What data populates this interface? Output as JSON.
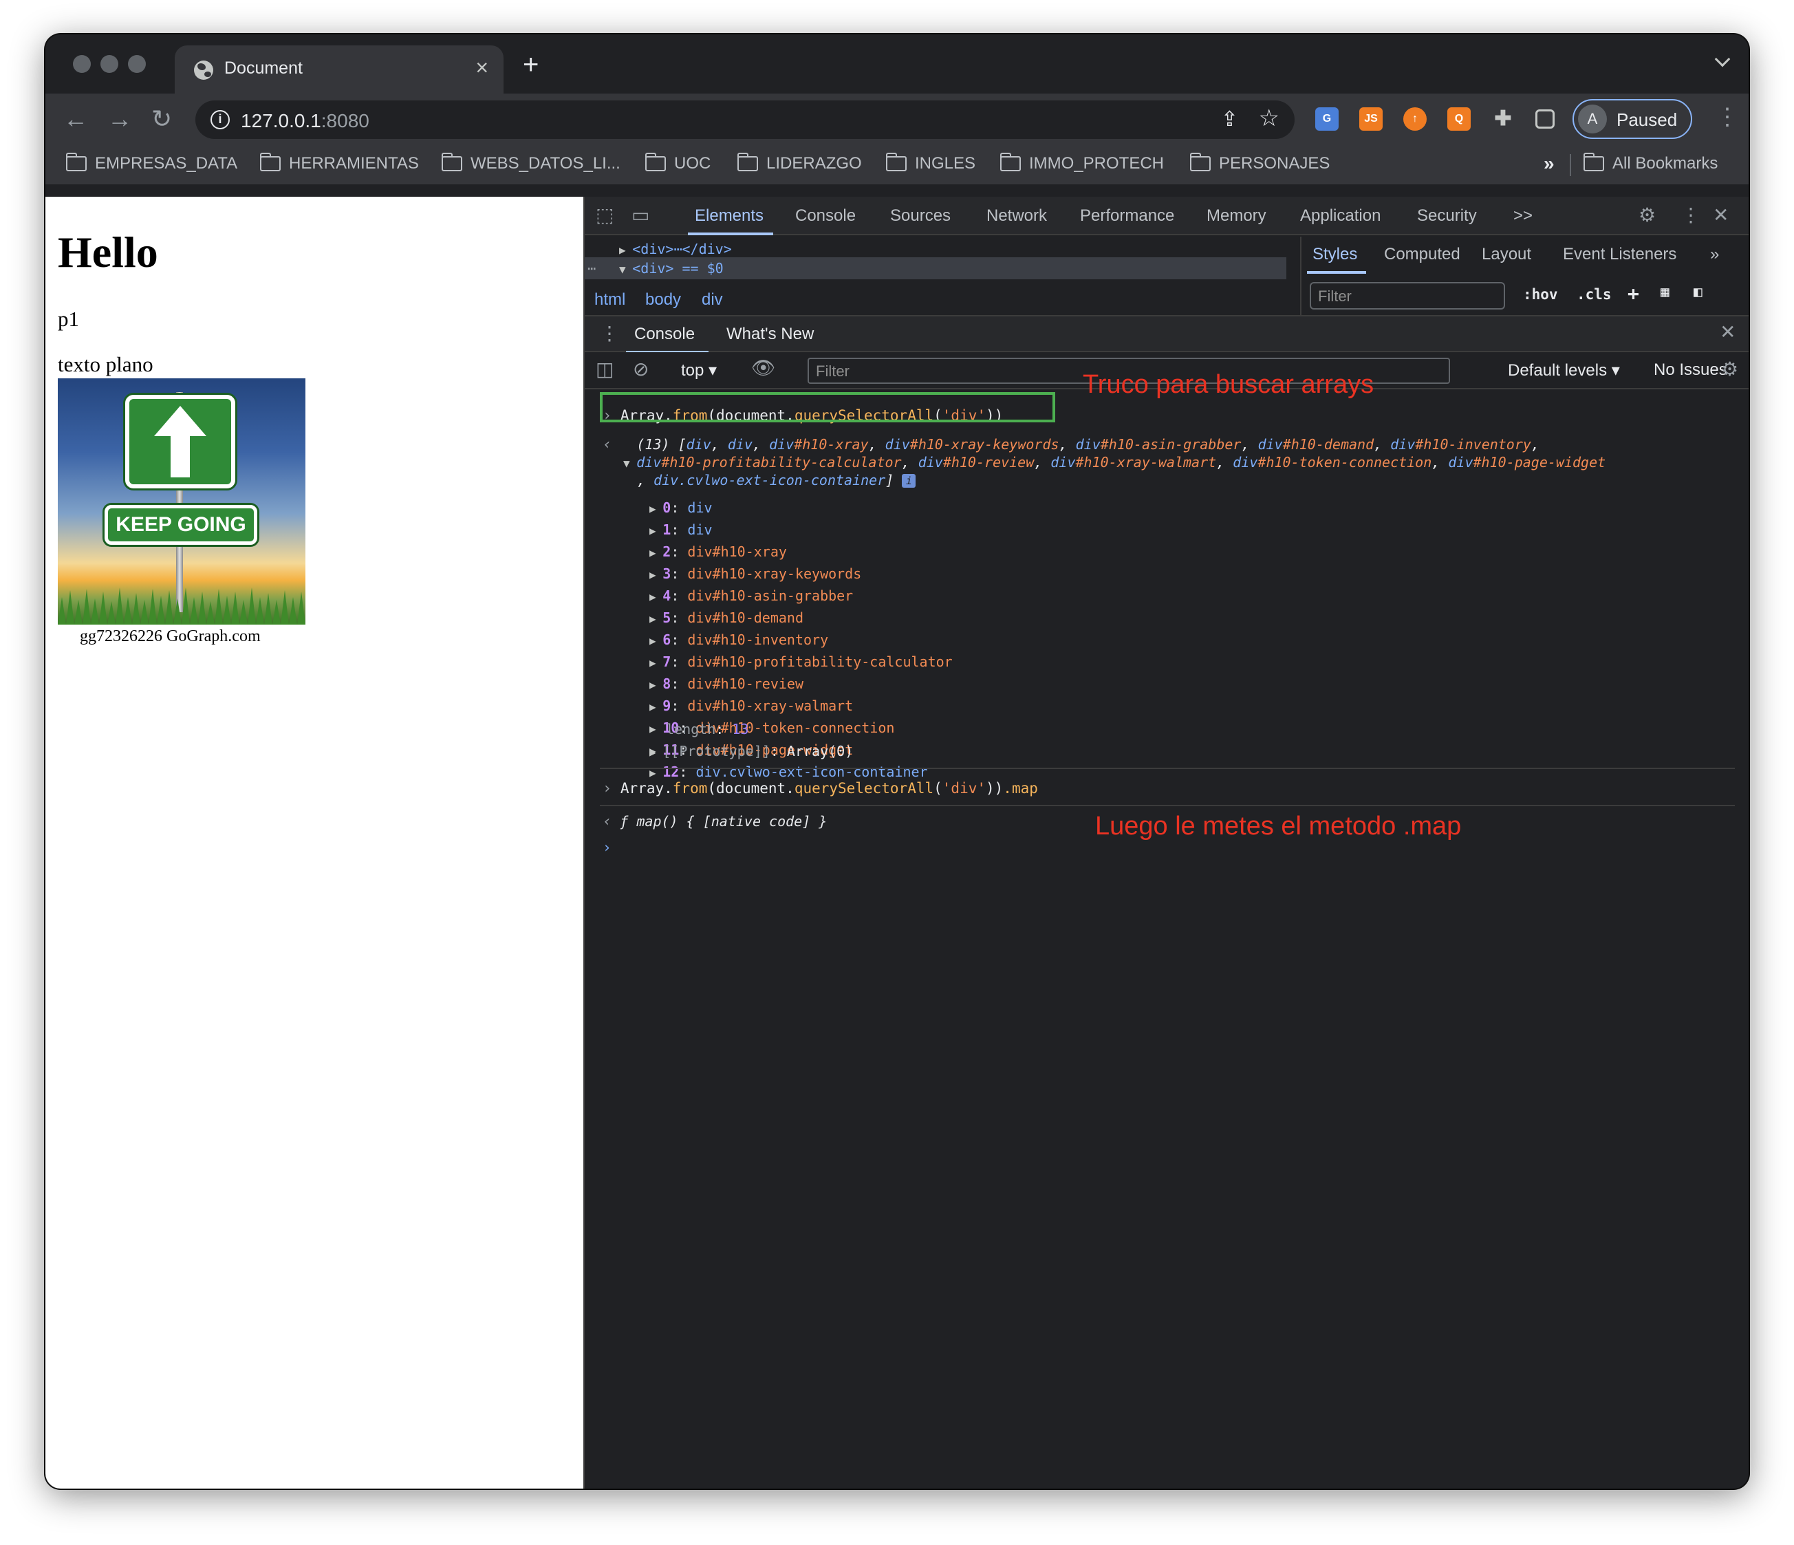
{
  "browser": {
    "tab_title": "Document",
    "tab_close": "×",
    "new_tab": "+",
    "url_host": "127.0.0.1",
    "url_port": ":8080",
    "profile_initial": "A",
    "profile_status": "Paused",
    "bookmarks": [
      "EMPRESAS_DATA",
      "HERRAMIENTAS",
      "WEBS_DATOS_LI...",
      "UOC",
      "LIDERAZGO",
      "INGLES",
      "IMMO_PROTECH",
      "PERSONAJES"
    ],
    "bookmarks_more": "»",
    "all_bookmarks": "All Bookmarks"
  },
  "page": {
    "heading": "Hello",
    "p1": "p1",
    "plain_text": "texto plano",
    "image_sign_text": "KEEP GOING",
    "image_caption": "gg72326226 GoGraph.com"
  },
  "devtools": {
    "tabs": [
      "Elements",
      "Console",
      "Sources",
      "Network",
      "Performance",
      "Memory",
      "Application",
      "Security"
    ],
    "more_tabs": ">>",
    "elements_line1": "<div>⋯</div>",
    "elements_line2": "<div> == $0",
    "breadcrumbs": [
      "html",
      "body",
      "div"
    ],
    "styles_tabs": [
      "Styles",
      "Computed",
      "Layout",
      "Event Listeners"
    ],
    "styles_filter_placeholder": "Filter",
    "styles_hov": ":hov",
    "styles_cls": ".cls",
    "drawer_tabs": [
      "Console",
      "What's New"
    ],
    "context": "top",
    "console_filter_placeholder": "Filter",
    "levels": "Default levels ▾",
    "issues": "No Issues"
  },
  "console": {
    "cmd1_obj": "Array",
    "cmd1_from": "from",
    "cmd1_doc": "document",
    "cmd1_qsa": "querySelectorAll",
    "cmd1_arg": "'div'",
    "summary_count": "(13)",
    "summary_line1": [
      {
        "t": "div",
        "k": "tag"
      },
      {
        "t": "div",
        "k": "tag"
      },
      {
        "t": "div#h10-xray",
        "k": "id"
      },
      {
        "t": "div#h10-xray-keywords",
        "k": "id"
      },
      {
        "t": "div#h10-asin-grabber",
        "k": "id"
      },
      {
        "t": "div#h10-demand",
        "k": "id"
      },
      {
        "t": "div#h10-inventory",
        "k": "id"
      }
    ],
    "summary_line2": [
      {
        "t": "div#h10-profitability-calculator",
        "k": "id"
      },
      {
        "t": "div#h10-review",
        "k": "id"
      },
      {
        "t": "div#h10-xray-walmart",
        "k": "id"
      },
      {
        "t": "div#h10-token-connection",
        "k": "id"
      },
      {
        "t": "div#h10-page-widget",
        "k": "id"
      }
    ],
    "summary_line3": "div.cvlwo-ext-icon-container",
    "items": [
      {
        "i": "0",
        "v": "div"
      },
      {
        "i": "1",
        "v": "div"
      },
      {
        "i": "2",
        "v": "div#h10-xray"
      },
      {
        "i": "3",
        "v": "div#h10-xray-keywords"
      },
      {
        "i": "4",
        "v": "div#h10-asin-grabber"
      },
      {
        "i": "5",
        "v": "div#h10-demand"
      },
      {
        "i": "6",
        "v": "div#h10-inventory"
      },
      {
        "i": "7",
        "v": "div#h10-profitability-calculator"
      },
      {
        "i": "8",
        "v": "div#h10-review"
      },
      {
        "i": "9",
        "v": "div#h10-xray-walmart"
      },
      {
        "i": "10",
        "v": "div#h10-token-connection"
      },
      {
        "i": "11",
        "v": "div#h10-page-widget"
      },
      {
        "i": "12",
        "v": "div.cvlwo-ext-icon-container"
      }
    ],
    "length_key": "length",
    "length_val": "13",
    "prototype_key": "[[Prototype]]",
    "prototype_val": "Array(0)",
    "cmd2_suffix": ".map",
    "result2": "ƒ map() { [native code] }"
  },
  "annotations": {
    "note1": "Truco para buscar arrays",
    "note2": "Luego le metes el metodo .map"
  },
  "colors": {
    "annotation_red": "#ea3323",
    "highlight_green": "#4caf50",
    "accent_blue": "#a8c7fa"
  }
}
